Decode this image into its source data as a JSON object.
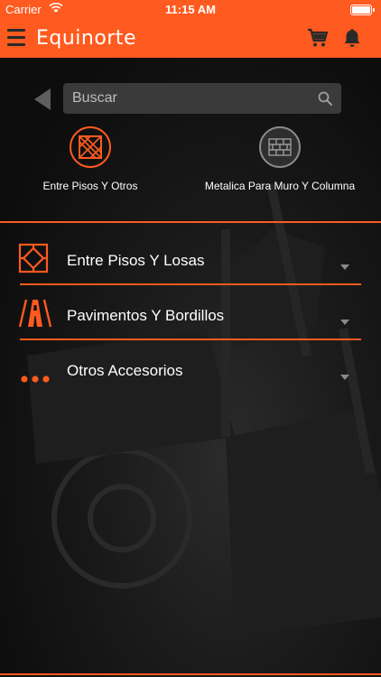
{
  "status_bar": {
    "carrier": "Carrier",
    "time": "11:15 AM"
  },
  "nav": {
    "logo": "Equinorte"
  },
  "search": {
    "placeholder": "Buscar"
  },
  "categories": [
    {
      "label": "Entre Pisos Y Otros",
      "selected": true
    },
    {
      "label": "Metalica Para Muro Y Columna",
      "selected": false
    }
  ],
  "list": [
    {
      "label": "Entre Pisos Y Losas",
      "icon": "floor-tile-icon"
    },
    {
      "label": "Pavimentos Y Bordillos",
      "icon": "road-icon"
    },
    {
      "label": "Otros Accesorios",
      "icon": "dots-icon"
    }
  ],
  "colors": {
    "accent": "#ff5a1f",
    "bar_dark": "#2a2a2a",
    "search_bg": "#3a3a3a"
  }
}
